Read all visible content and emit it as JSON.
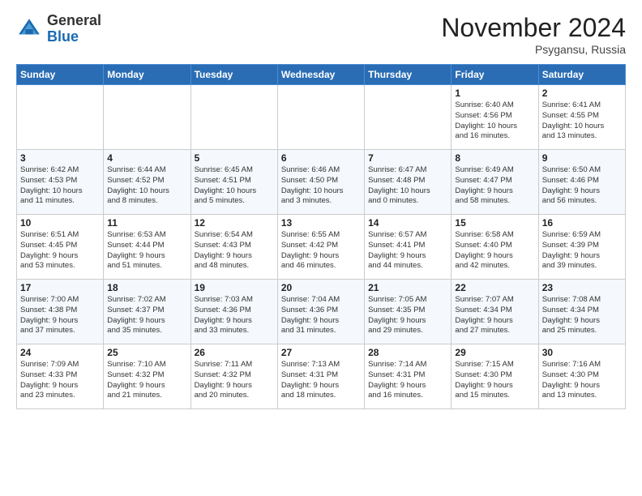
{
  "header": {
    "logo_general": "General",
    "logo_blue": "Blue",
    "month": "November 2024",
    "location": "Psygansu, Russia"
  },
  "weekdays": [
    "Sunday",
    "Monday",
    "Tuesday",
    "Wednesday",
    "Thursday",
    "Friday",
    "Saturday"
  ],
  "weeks": [
    [
      {
        "day": "",
        "info": ""
      },
      {
        "day": "",
        "info": ""
      },
      {
        "day": "",
        "info": ""
      },
      {
        "day": "",
        "info": ""
      },
      {
        "day": "",
        "info": ""
      },
      {
        "day": "1",
        "info": "Sunrise: 6:40 AM\nSunset: 4:56 PM\nDaylight: 10 hours\nand 16 minutes."
      },
      {
        "day": "2",
        "info": "Sunrise: 6:41 AM\nSunset: 4:55 PM\nDaylight: 10 hours\nand 13 minutes."
      }
    ],
    [
      {
        "day": "3",
        "info": "Sunrise: 6:42 AM\nSunset: 4:53 PM\nDaylight: 10 hours\nand 11 minutes."
      },
      {
        "day": "4",
        "info": "Sunrise: 6:44 AM\nSunset: 4:52 PM\nDaylight: 10 hours\nand 8 minutes."
      },
      {
        "day": "5",
        "info": "Sunrise: 6:45 AM\nSunset: 4:51 PM\nDaylight: 10 hours\nand 5 minutes."
      },
      {
        "day": "6",
        "info": "Sunrise: 6:46 AM\nSunset: 4:50 PM\nDaylight: 10 hours\nand 3 minutes."
      },
      {
        "day": "7",
        "info": "Sunrise: 6:47 AM\nSunset: 4:48 PM\nDaylight: 10 hours\nand 0 minutes."
      },
      {
        "day": "8",
        "info": "Sunrise: 6:49 AM\nSunset: 4:47 PM\nDaylight: 9 hours\nand 58 minutes."
      },
      {
        "day": "9",
        "info": "Sunrise: 6:50 AM\nSunset: 4:46 PM\nDaylight: 9 hours\nand 56 minutes."
      }
    ],
    [
      {
        "day": "10",
        "info": "Sunrise: 6:51 AM\nSunset: 4:45 PM\nDaylight: 9 hours\nand 53 minutes."
      },
      {
        "day": "11",
        "info": "Sunrise: 6:53 AM\nSunset: 4:44 PM\nDaylight: 9 hours\nand 51 minutes."
      },
      {
        "day": "12",
        "info": "Sunrise: 6:54 AM\nSunset: 4:43 PM\nDaylight: 9 hours\nand 48 minutes."
      },
      {
        "day": "13",
        "info": "Sunrise: 6:55 AM\nSunset: 4:42 PM\nDaylight: 9 hours\nand 46 minutes."
      },
      {
        "day": "14",
        "info": "Sunrise: 6:57 AM\nSunset: 4:41 PM\nDaylight: 9 hours\nand 44 minutes."
      },
      {
        "day": "15",
        "info": "Sunrise: 6:58 AM\nSunset: 4:40 PM\nDaylight: 9 hours\nand 42 minutes."
      },
      {
        "day": "16",
        "info": "Sunrise: 6:59 AM\nSunset: 4:39 PM\nDaylight: 9 hours\nand 39 minutes."
      }
    ],
    [
      {
        "day": "17",
        "info": "Sunrise: 7:00 AM\nSunset: 4:38 PM\nDaylight: 9 hours\nand 37 minutes."
      },
      {
        "day": "18",
        "info": "Sunrise: 7:02 AM\nSunset: 4:37 PM\nDaylight: 9 hours\nand 35 minutes."
      },
      {
        "day": "19",
        "info": "Sunrise: 7:03 AM\nSunset: 4:36 PM\nDaylight: 9 hours\nand 33 minutes."
      },
      {
        "day": "20",
        "info": "Sunrise: 7:04 AM\nSunset: 4:36 PM\nDaylight: 9 hours\nand 31 minutes."
      },
      {
        "day": "21",
        "info": "Sunrise: 7:05 AM\nSunset: 4:35 PM\nDaylight: 9 hours\nand 29 minutes."
      },
      {
        "day": "22",
        "info": "Sunrise: 7:07 AM\nSunset: 4:34 PM\nDaylight: 9 hours\nand 27 minutes."
      },
      {
        "day": "23",
        "info": "Sunrise: 7:08 AM\nSunset: 4:34 PM\nDaylight: 9 hours\nand 25 minutes."
      }
    ],
    [
      {
        "day": "24",
        "info": "Sunrise: 7:09 AM\nSunset: 4:33 PM\nDaylight: 9 hours\nand 23 minutes."
      },
      {
        "day": "25",
        "info": "Sunrise: 7:10 AM\nSunset: 4:32 PM\nDaylight: 9 hours\nand 21 minutes."
      },
      {
        "day": "26",
        "info": "Sunrise: 7:11 AM\nSunset: 4:32 PM\nDaylight: 9 hours\nand 20 minutes."
      },
      {
        "day": "27",
        "info": "Sunrise: 7:13 AM\nSunset: 4:31 PM\nDaylight: 9 hours\nand 18 minutes."
      },
      {
        "day": "28",
        "info": "Sunrise: 7:14 AM\nSunset: 4:31 PM\nDaylight: 9 hours\nand 16 minutes."
      },
      {
        "day": "29",
        "info": "Sunrise: 7:15 AM\nSunset: 4:30 PM\nDaylight: 9 hours\nand 15 minutes."
      },
      {
        "day": "30",
        "info": "Sunrise: 7:16 AM\nSunset: 4:30 PM\nDaylight: 9 hours\nand 13 minutes."
      }
    ]
  ]
}
